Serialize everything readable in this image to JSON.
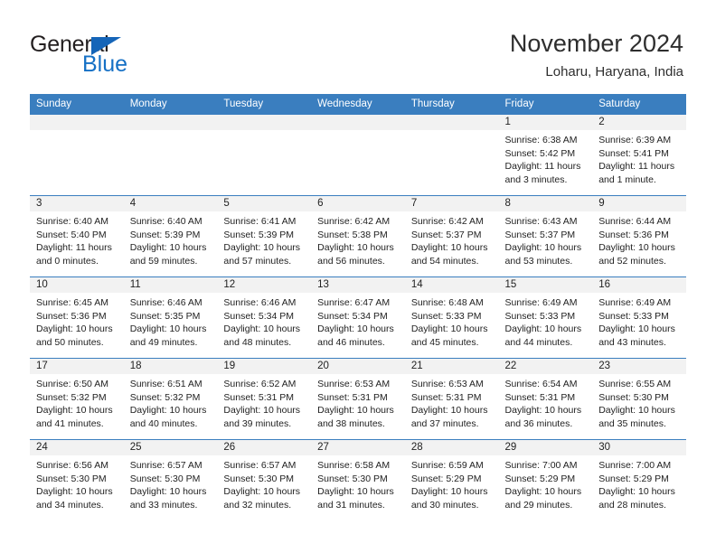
{
  "logo": {
    "word_top": "General",
    "word_bottom": "Blue",
    "triangle_color": "#1565b8",
    "blue_text_color": "#1570c5"
  },
  "header": {
    "title": "November 2024",
    "subtitle": "Loharu, Haryana, India"
  },
  "theme": {
    "header_blue": "#3a7ebf",
    "day_strip_gray": "#f2f2f2",
    "text": "#222222"
  },
  "weekday_headers": [
    "Sunday",
    "Monday",
    "Tuesday",
    "Wednesday",
    "Thursday",
    "Friday",
    "Saturday"
  ],
  "weeks": [
    [
      {
        "empty": true
      },
      {
        "empty": true
      },
      {
        "empty": true
      },
      {
        "empty": true
      },
      {
        "empty": true
      },
      {
        "day": "1",
        "sunrise": "Sunrise: 6:38 AM",
        "sunset": "Sunset: 5:42 PM",
        "daylight": "Daylight: 11 hours and 3 minutes."
      },
      {
        "day": "2",
        "sunrise": "Sunrise: 6:39 AM",
        "sunset": "Sunset: 5:41 PM",
        "daylight": "Daylight: 11 hours and 1 minute."
      }
    ],
    [
      {
        "day": "3",
        "sunrise": "Sunrise: 6:40 AM",
        "sunset": "Sunset: 5:40 PM",
        "daylight": "Daylight: 11 hours and 0 minutes."
      },
      {
        "day": "4",
        "sunrise": "Sunrise: 6:40 AM",
        "sunset": "Sunset: 5:39 PM",
        "daylight": "Daylight: 10 hours and 59 minutes."
      },
      {
        "day": "5",
        "sunrise": "Sunrise: 6:41 AM",
        "sunset": "Sunset: 5:39 PM",
        "daylight": "Daylight: 10 hours and 57 minutes."
      },
      {
        "day": "6",
        "sunrise": "Sunrise: 6:42 AM",
        "sunset": "Sunset: 5:38 PM",
        "daylight": "Daylight: 10 hours and 56 minutes."
      },
      {
        "day": "7",
        "sunrise": "Sunrise: 6:42 AM",
        "sunset": "Sunset: 5:37 PM",
        "daylight": "Daylight: 10 hours and 54 minutes."
      },
      {
        "day": "8",
        "sunrise": "Sunrise: 6:43 AM",
        "sunset": "Sunset: 5:37 PM",
        "daylight": "Daylight: 10 hours and 53 minutes."
      },
      {
        "day": "9",
        "sunrise": "Sunrise: 6:44 AM",
        "sunset": "Sunset: 5:36 PM",
        "daylight": "Daylight: 10 hours and 52 minutes."
      }
    ],
    [
      {
        "day": "10",
        "sunrise": "Sunrise: 6:45 AM",
        "sunset": "Sunset: 5:36 PM",
        "daylight": "Daylight: 10 hours and 50 minutes."
      },
      {
        "day": "11",
        "sunrise": "Sunrise: 6:46 AM",
        "sunset": "Sunset: 5:35 PM",
        "daylight": "Daylight: 10 hours and 49 minutes."
      },
      {
        "day": "12",
        "sunrise": "Sunrise: 6:46 AM",
        "sunset": "Sunset: 5:34 PM",
        "daylight": "Daylight: 10 hours and 48 minutes."
      },
      {
        "day": "13",
        "sunrise": "Sunrise: 6:47 AM",
        "sunset": "Sunset: 5:34 PM",
        "daylight": "Daylight: 10 hours and 46 minutes."
      },
      {
        "day": "14",
        "sunrise": "Sunrise: 6:48 AM",
        "sunset": "Sunset: 5:33 PM",
        "daylight": "Daylight: 10 hours and 45 minutes."
      },
      {
        "day": "15",
        "sunrise": "Sunrise: 6:49 AM",
        "sunset": "Sunset: 5:33 PM",
        "daylight": "Daylight: 10 hours and 44 minutes."
      },
      {
        "day": "16",
        "sunrise": "Sunrise: 6:49 AM",
        "sunset": "Sunset: 5:33 PM",
        "daylight": "Daylight: 10 hours and 43 minutes."
      }
    ],
    [
      {
        "day": "17",
        "sunrise": "Sunrise: 6:50 AM",
        "sunset": "Sunset: 5:32 PM",
        "daylight": "Daylight: 10 hours and 41 minutes."
      },
      {
        "day": "18",
        "sunrise": "Sunrise: 6:51 AM",
        "sunset": "Sunset: 5:32 PM",
        "daylight": "Daylight: 10 hours and 40 minutes."
      },
      {
        "day": "19",
        "sunrise": "Sunrise: 6:52 AM",
        "sunset": "Sunset: 5:31 PM",
        "daylight": "Daylight: 10 hours and 39 minutes."
      },
      {
        "day": "20",
        "sunrise": "Sunrise: 6:53 AM",
        "sunset": "Sunset: 5:31 PM",
        "daylight": "Daylight: 10 hours and 38 minutes."
      },
      {
        "day": "21",
        "sunrise": "Sunrise: 6:53 AM",
        "sunset": "Sunset: 5:31 PM",
        "daylight": "Daylight: 10 hours and 37 minutes."
      },
      {
        "day": "22",
        "sunrise": "Sunrise: 6:54 AM",
        "sunset": "Sunset: 5:31 PM",
        "daylight": "Daylight: 10 hours and 36 minutes."
      },
      {
        "day": "23",
        "sunrise": "Sunrise: 6:55 AM",
        "sunset": "Sunset: 5:30 PM",
        "daylight": "Daylight: 10 hours and 35 minutes."
      }
    ],
    [
      {
        "day": "24",
        "sunrise": "Sunrise: 6:56 AM",
        "sunset": "Sunset: 5:30 PM",
        "daylight": "Daylight: 10 hours and 34 minutes."
      },
      {
        "day": "25",
        "sunrise": "Sunrise: 6:57 AM",
        "sunset": "Sunset: 5:30 PM",
        "daylight": "Daylight: 10 hours and 33 minutes."
      },
      {
        "day": "26",
        "sunrise": "Sunrise: 6:57 AM",
        "sunset": "Sunset: 5:30 PM",
        "daylight": "Daylight: 10 hours and 32 minutes."
      },
      {
        "day": "27",
        "sunrise": "Sunrise: 6:58 AM",
        "sunset": "Sunset: 5:30 PM",
        "daylight": "Daylight: 10 hours and 31 minutes."
      },
      {
        "day": "28",
        "sunrise": "Sunrise: 6:59 AM",
        "sunset": "Sunset: 5:29 PM",
        "daylight": "Daylight: 10 hours and 30 minutes."
      },
      {
        "day": "29",
        "sunrise": "Sunrise: 7:00 AM",
        "sunset": "Sunset: 5:29 PM",
        "daylight": "Daylight: 10 hours and 29 minutes."
      },
      {
        "day": "30",
        "sunrise": "Sunrise: 7:00 AM",
        "sunset": "Sunset: 5:29 PM",
        "daylight": "Daylight: 10 hours and 28 minutes."
      }
    ]
  ]
}
